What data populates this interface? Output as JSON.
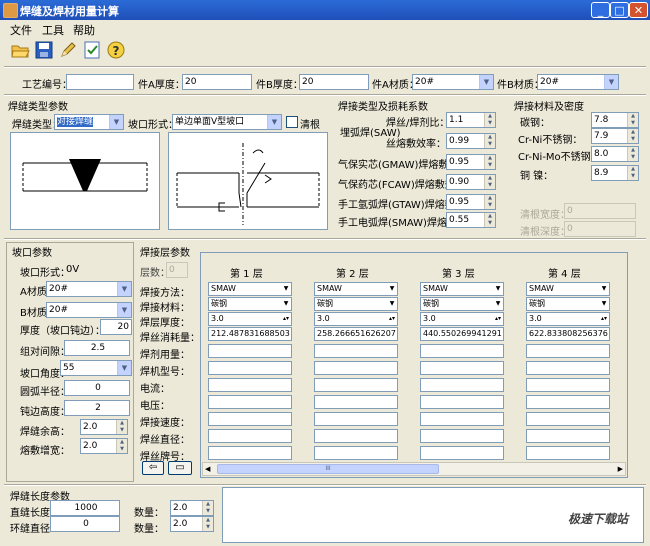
{
  "window": {
    "title": "焊缝及焊材用量计算"
  },
  "menu": [
    "文件",
    "工具",
    "帮助"
  ],
  "toolbar": [
    {
      "name": "open-folder-icon"
    },
    {
      "name": "save-icon"
    },
    {
      "name": "pencil-icon"
    },
    {
      "name": "calculate-icon"
    },
    {
      "name": "help-icon"
    }
  ],
  "top": {
    "process_no_label": "工艺编号：",
    "process_no": "",
    "a_thick_label": "件A厚度：",
    "a_thick": "20",
    "b_thick_label": "件B厚度：",
    "b_thick": "20",
    "a_mat_label": "件A材质：",
    "a_mat": "20#",
    "b_mat_label": "件B材质：",
    "b_mat": "20#"
  },
  "seam_type": {
    "section": "焊缝类型参数",
    "type_label": "焊缝类型：",
    "type_value": "对接焊缝",
    "groove_label": "坡口形式：",
    "groove_value": "单边单面V型坡口",
    "backing_label": "清根"
  },
  "process_coef": {
    "section": "焊接类型及损耗系数",
    "saw": "埋弧焊(SAW)",
    "flux_ratio_label": "焊丝/焊剂比：",
    "flux_ratio": "1.1",
    "wire_eff_label": "丝熔敷效率：",
    "wire_eff": "0.99",
    "gmaw_label": "气保实芯(GMAW)焊熔敷效率：",
    "gmaw": "0.95",
    "fcaw_label": "气保药芯(FCAW)焊熔敷效率：",
    "fcaw": "0.90",
    "gtaw_label": "手工氩弧焊(GTAW)焊熔敷效率：",
    "gtaw": "0.95",
    "smaw_label": "手工电弧焊(SMAW)焊熔敷效率：",
    "smaw": "0.55"
  },
  "density": {
    "section": "焊接材料及密度",
    "cs_label": "碳钢：",
    "cs": "7.8",
    "crni_label": "Cr-Ni不锈钢：",
    "crni": "7.9",
    "crnimo_label": "Cr-Ni-Mo不锈钢：",
    "crnimo": "8.0",
    "cu_label": "铜 镍：",
    "cu": "8.9",
    "width_label": "清根宽度：",
    "width": "0",
    "depth_label": "清根深度：",
    "depth": "0"
  },
  "groove": {
    "section": "坡口参数",
    "form_label": "坡口形式：",
    "form": "0V",
    "a_mat_label": "A材质：",
    "a_mat": "20#",
    "b_mat_label": "B材质：",
    "b_mat": "20#",
    "thick_label": "厚度（坡口钝边）：",
    "thick": "20",
    "gap_label": "组对间隙：",
    "gap": "2.5",
    "angle_label": "坡口角度：",
    "angle": "55",
    "radius_label": "圆弧半径：",
    "radius": "0",
    "root_label": "钝边高度：",
    "root": "2",
    "reinf_label": "焊缝余高：",
    "reinf": "2.0",
    "width_inc_label": "熔敷增宽：",
    "width_inc": "2.0"
  },
  "layer_params": {
    "section": "焊接层参数",
    "count_label": "层数：",
    "count": "0",
    "row_labels": [
      "焊接方法：",
      "焊接材料：",
      "焊层厚度：",
      "焊丝消耗量：",
      "焊剂用量：",
      "焊机型号：",
      "电流：",
      "电压：",
      "焊接速度：",
      "焊丝直径：",
      "焊丝牌号："
    ],
    "layers": [
      {
        "title": "第 1 层",
        "method": "SMAW",
        "material": "碳钢",
        "thickness": "3.0",
        "consumption": "212.487831688503"
      },
      {
        "title": "第 2 层",
        "method": "SMAW",
        "material": "碳钢",
        "thickness": "3.0",
        "consumption": "258.266651626207"
      },
      {
        "title": "第 3 层",
        "method": "SMAW",
        "material": "碳钢",
        "thickness": "3.0",
        "consumption": "440.550269941291"
      },
      {
        "title": "第 4 层",
        "method": "SMAW",
        "material": "碳钢",
        "thickness": "3.0",
        "consumption": "622.833808256376"
      }
    ],
    "scroll_marker": "III"
  },
  "seam_length": {
    "section": "焊缝长度参数",
    "straight_label": "直缝长度：",
    "straight": "1000",
    "ring_label": "环缝直径：",
    "ring": "0",
    "qty1_label": "数量：",
    "qty1": "2.0",
    "qty2_label": "数量：",
    "qty2": "2.0"
  },
  "watermark": "极速下载站"
}
